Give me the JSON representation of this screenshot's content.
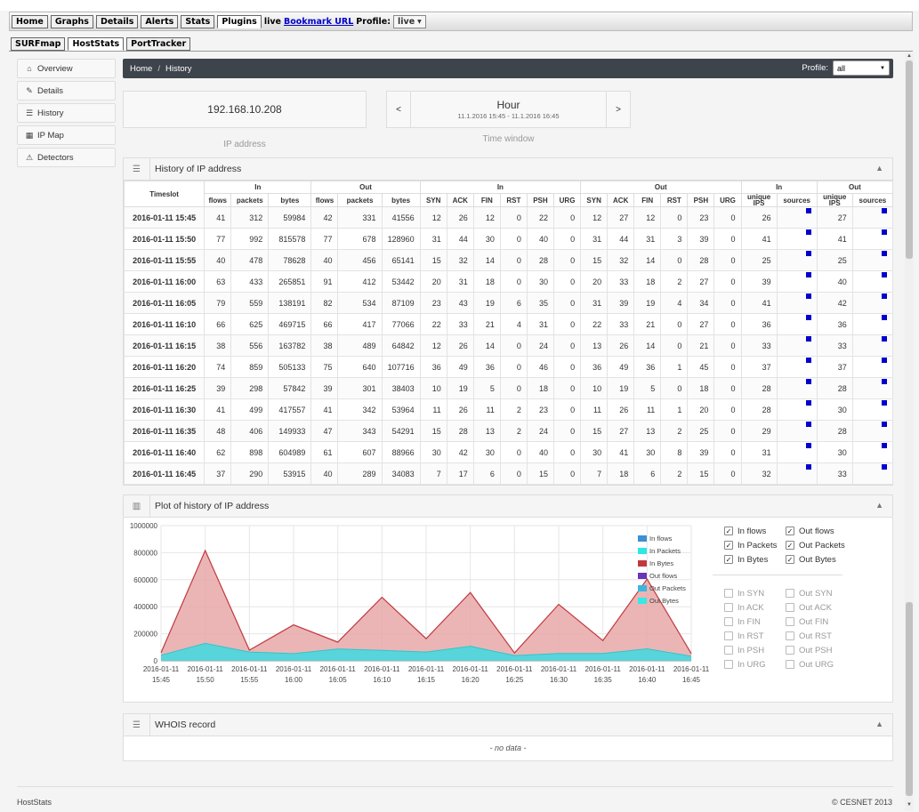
{
  "topbar": {
    "buttons": [
      "Home",
      "Graphs",
      "Details",
      "Alerts",
      "Stats",
      "Plugins"
    ],
    "live": "live",
    "bookmark": "Bookmark URL",
    "profile_label": "Profile:",
    "profile_value": "live"
  },
  "subtabs": [
    "SURFmap",
    "HostStats",
    "PortTracker"
  ],
  "sidebar": {
    "items": [
      {
        "label": "Overview",
        "icon": "home-icon"
      },
      {
        "label": "Details",
        "icon": "edit-icon"
      },
      {
        "label": "History",
        "icon": "list-icon"
      },
      {
        "label": "IP Map",
        "icon": "grid-icon"
      },
      {
        "label": "Detectors",
        "icon": "warning-icon"
      }
    ]
  },
  "breadcrumb": {
    "home": "Home",
    "sep": "/",
    "current": "History"
  },
  "profile": {
    "label": "Profile:",
    "value": "all"
  },
  "ip": {
    "value": "192.168.10.208",
    "label": "IP address"
  },
  "time_window": {
    "prev": "<",
    "next": ">",
    "title": "Hour",
    "range": "11.1.2016 15:45 - 11.1.2016 16:45",
    "label": "Time window"
  },
  "history": {
    "title": "History of IP address",
    "groups": {
      "in": "In",
      "out": "Out"
    },
    "timeslot": "Timeslot",
    "cols_traffic": [
      "flows",
      "packets",
      "bytes"
    ],
    "cols_flags": [
      "SYN",
      "ACK",
      "FIN",
      "RST",
      "PSH",
      "URG"
    ],
    "unique_ips": "unique IPS",
    "sources": "sources",
    "rows": [
      [
        "2016-01-11 15:45",
        "41",
        "312",
        "59984",
        "42",
        "331",
        "41556",
        "12",
        "26",
        "12",
        "0",
        "22",
        "0",
        "12",
        "27",
        "12",
        "0",
        "23",
        "0",
        "26",
        "27"
      ],
      [
        "2016-01-11 15:50",
        "77",
        "992",
        "815578",
        "77",
        "678",
        "128960",
        "31",
        "44",
        "30",
        "0",
        "40",
        "0",
        "31",
        "44",
        "31",
        "3",
        "39",
        "0",
        "41",
        "41"
      ],
      [
        "2016-01-11 15:55",
        "40",
        "478",
        "78628",
        "40",
        "456",
        "65141",
        "15",
        "32",
        "14",
        "0",
        "28",
        "0",
        "15",
        "32",
        "14",
        "0",
        "28",
        "0",
        "25",
        "25"
      ],
      [
        "2016-01-11 16:00",
        "63",
        "433",
        "265851",
        "91",
        "412",
        "53442",
        "20",
        "31",
        "18",
        "0",
        "30",
        "0",
        "20",
        "33",
        "18",
        "2",
        "27",
        "0",
        "39",
        "40"
      ],
      [
        "2016-01-11 16:05",
        "79",
        "559",
        "138191",
        "82",
        "534",
        "87109",
        "23",
        "43",
        "19",
        "6",
        "35",
        "0",
        "31",
        "39",
        "19",
        "4",
        "34",
        "0",
        "41",
        "42"
      ],
      [
        "2016-01-11 16:10",
        "66",
        "625",
        "469715",
        "66",
        "417",
        "77066",
        "22",
        "33",
        "21",
        "4",
        "31",
        "0",
        "22",
        "33",
        "21",
        "0",
        "27",
        "0",
        "36",
        "36"
      ],
      [
        "2016-01-11 16:15",
        "38",
        "556",
        "163782",
        "38",
        "489",
        "64842",
        "12",
        "26",
        "14",
        "0",
        "24",
        "0",
        "13",
        "26",
        "14",
        "0",
        "21",
        "0",
        "33",
        "33"
      ],
      [
        "2016-01-11 16:20",
        "74",
        "859",
        "505133",
        "75",
        "640",
        "107716",
        "36",
        "49",
        "36",
        "0",
        "46",
        "0",
        "36",
        "49",
        "36",
        "1",
        "45",
        "0",
        "37",
        "37"
      ],
      [
        "2016-01-11 16:25",
        "39",
        "298",
        "57842",
        "39",
        "301",
        "38403",
        "10",
        "19",
        "5",
        "0",
        "18",
        "0",
        "10",
        "19",
        "5",
        "0",
        "18",
        "0",
        "28",
        "28"
      ],
      [
        "2016-01-11 16:30",
        "41",
        "499",
        "417557",
        "41",
        "342",
        "53964",
        "11",
        "26",
        "11",
        "2",
        "23",
        "0",
        "11",
        "26",
        "11",
        "1",
        "20",
        "0",
        "28",
        "30"
      ],
      [
        "2016-01-11 16:35",
        "48",
        "406",
        "149933",
        "47",
        "343",
        "54291",
        "15",
        "28",
        "13",
        "2",
        "24",
        "0",
        "15",
        "27",
        "13",
        "2",
        "25",
        "0",
        "29",
        "28"
      ],
      [
        "2016-01-11 16:40",
        "62",
        "898",
        "604989",
        "61",
        "607",
        "88966",
        "30",
        "42",
        "30",
        "0",
        "40",
        "0",
        "30",
        "41",
        "30",
        "8",
        "39",
        "0",
        "31",
        "30"
      ],
      [
        "2016-01-11 16:45",
        "37",
        "290",
        "53915",
        "40",
        "289",
        "34083",
        "7",
        "17",
        "6",
        "0",
        "15",
        "0",
        "7",
        "18",
        "6",
        "2",
        "15",
        "0",
        "32",
        "33"
      ]
    ]
  },
  "plot": {
    "title": "Plot of history of IP address",
    "legend": [
      "In flows",
      "In Packets",
      "In Bytes",
      "Out flows",
      "Out Packets",
      "Out Bytes"
    ],
    "legend_colors": [
      "#3d8fd6",
      "#2ee6e6",
      "#c0393e",
      "#6a35b8",
      "#3ab6e0",
      "#36e8e8"
    ],
    "checks_top": [
      {
        "in": "In flows",
        "in_checked": true,
        "out": "Out flows",
        "out_checked": true
      },
      {
        "in": "In Packets",
        "in_checked": true,
        "out": "Out Packets",
        "out_checked": true
      },
      {
        "in": "In Bytes",
        "in_checked": true,
        "out": "Out Bytes",
        "out_checked": true
      }
    ],
    "checks_bottom": [
      {
        "in": "In SYN",
        "out": "Out SYN"
      },
      {
        "in": "In ACK",
        "out": "Out ACK"
      },
      {
        "in": "In FIN",
        "out": "Out FIN"
      },
      {
        "in": "In RST",
        "out": "Out RST"
      },
      {
        "in": "In PSH",
        "out": "Out PSH"
      },
      {
        "in": "In URG",
        "out": "Out URG"
      }
    ]
  },
  "chart_data": {
    "type": "area",
    "x": [
      "2016-01-11 15:45",
      "2016-01-11 15:50",
      "2016-01-11 15:55",
      "2016-01-11 16:00",
      "2016-01-11 16:05",
      "2016-01-11 16:10",
      "2016-01-11 16:15",
      "2016-01-11 16:20",
      "2016-01-11 16:25",
      "2016-01-11 16:30",
      "2016-01-11 16:35",
      "2016-01-11 16:40",
      "2016-01-11 16:45"
    ],
    "series": [
      {
        "name": "In Bytes",
        "values": [
          59984,
          815578,
          78628,
          265851,
          138191,
          469715,
          163782,
          505133,
          57842,
          417557,
          149933,
          604989,
          53915
        ]
      },
      {
        "name": "Out Bytes",
        "values": [
          41556,
          128960,
          65141,
          53442,
          87109,
          77066,
          64842,
          107716,
          38403,
          53964,
          54291,
          88966,
          34083
        ]
      }
    ],
    "yticks": [
      "0",
      "200000",
      "400000",
      "600000",
      "800000",
      "1000000"
    ],
    "ylim": [
      0,
      1000000
    ],
    "grid": true,
    "legend_position": "top-right"
  },
  "whois": {
    "title": "WHOIS record",
    "body": "- no data -"
  },
  "footer": {
    "left": "HostStats",
    "right": "© CESNET 2013"
  }
}
